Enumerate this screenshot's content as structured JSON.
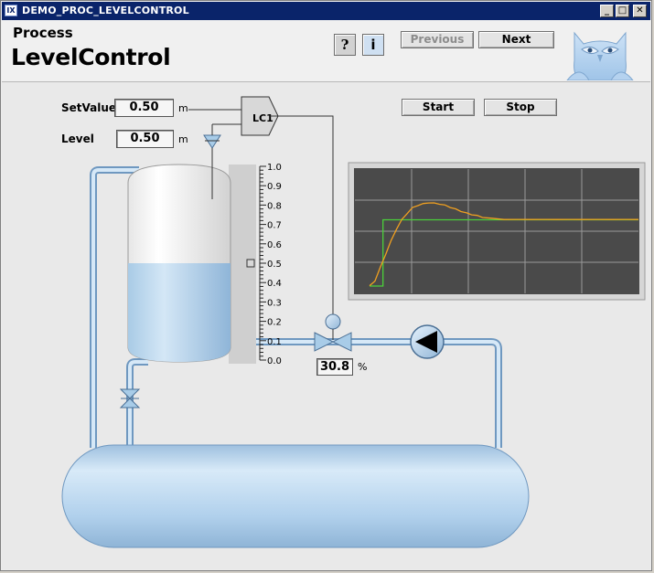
{
  "window": {
    "title": "DEMO_PROC_LEVELCONTROL",
    "controls": [
      "_",
      "□",
      "✕"
    ]
  },
  "header": {
    "section": "Process",
    "title": "LevelControl",
    "help_label": "?",
    "info_label": "i",
    "previous_label": "Previous",
    "next_label": "Next"
  },
  "controls": {
    "start_label": "Start",
    "stop_label": "Stop",
    "setvalue_label": "SetValue",
    "setvalue": "0.50",
    "setvalue_unit": "m",
    "level_label": "Level",
    "level": "0.50",
    "level_unit": "m"
  },
  "process": {
    "controller_label": "LC1",
    "valve_opening": "30.8",
    "valve_unit": "%",
    "tank_level_fraction": 0.5,
    "scale_ticks": [
      "1.0",
      "0.9",
      "0.8",
      "0.7",
      "0.6",
      "0.5",
      "0.4",
      "0.3",
      "0.2",
      "0.1",
      "0.0"
    ]
  },
  "colors": {
    "liquid": "#a8cce8",
    "pipe": "#b4d4ec",
    "trend_bg": "#4a4a4a",
    "setpoint_trace": "#4ad03a",
    "level_trace": "#f0a020"
  },
  "trend": {
    "setpoint_step_fraction": 0.05,
    "setpoint_value": 0.5,
    "level_points": [
      [
        0.0,
        0.0
      ],
      [
        0.02,
        0.04
      ],
      [
        0.04,
        0.14
      ],
      [
        0.06,
        0.24
      ],
      [
        0.08,
        0.34
      ],
      [
        0.1,
        0.43
      ],
      [
        0.12,
        0.5
      ],
      [
        0.14,
        0.55
      ],
      [
        0.16,
        0.59
      ],
      [
        0.18,
        0.61
      ],
      [
        0.2,
        0.62
      ],
      [
        0.22,
        0.63
      ],
      [
        0.24,
        0.625
      ],
      [
        0.26,
        0.62
      ],
      [
        0.28,
        0.61
      ],
      [
        0.3,
        0.595
      ],
      [
        0.32,
        0.58
      ],
      [
        0.34,
        0.565
      ],
      [
        0.36,
        0.55
      ],
      [
        0.38,
        0.54
      ],
      [
        0.4,
        0.53
      ],
      [
        0.42,
        0.52
      ],
      [
        0.45,
        0.51
      ],
      [
        0.5,
        0.505
      ],
      [
        0.55,
        0.5
      ],
      [
        0.6,
        0.505
      ],
      [
        0.65,
        0.5
      ],
      [
        0.7,
        0.505
      ],
      [
        0.75,
        0.5
      ],
      [
        0.8,
        0.505
      ],
      [
        0.85,
        0.5
      ],
      [
        0.9,
        0.505
      ],
      [
        0.95,
        0.5
      ],
      [
        1.0,
        0.505
      ]
    ]
  }
}
